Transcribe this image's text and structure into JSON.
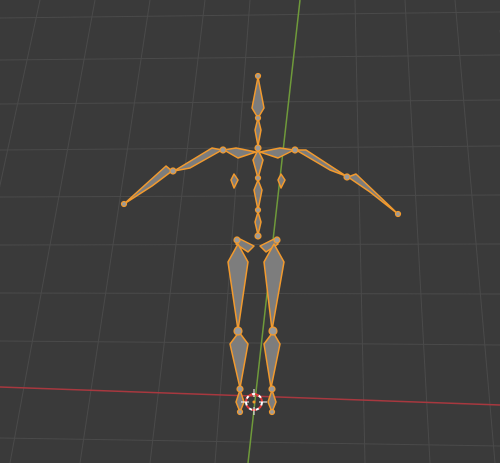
{
  "viewport": {
    "background": "#3a3a3a",
    "grid_color": "#4a4a4a",
    "x_axis_color": "#a8383f",
    "y_axis_color": "#6f9a3a",
    "bone_fill": "#7d7d7d",
    "bone_outline": "#f29a2e",
    "joint_fill": "#9a9a9a"
  },
  "scene": {
    "object": "armature-skeleton",
    "selection_state": "selected",
    "cursor": "3d-cursor-icon"
  }
}
